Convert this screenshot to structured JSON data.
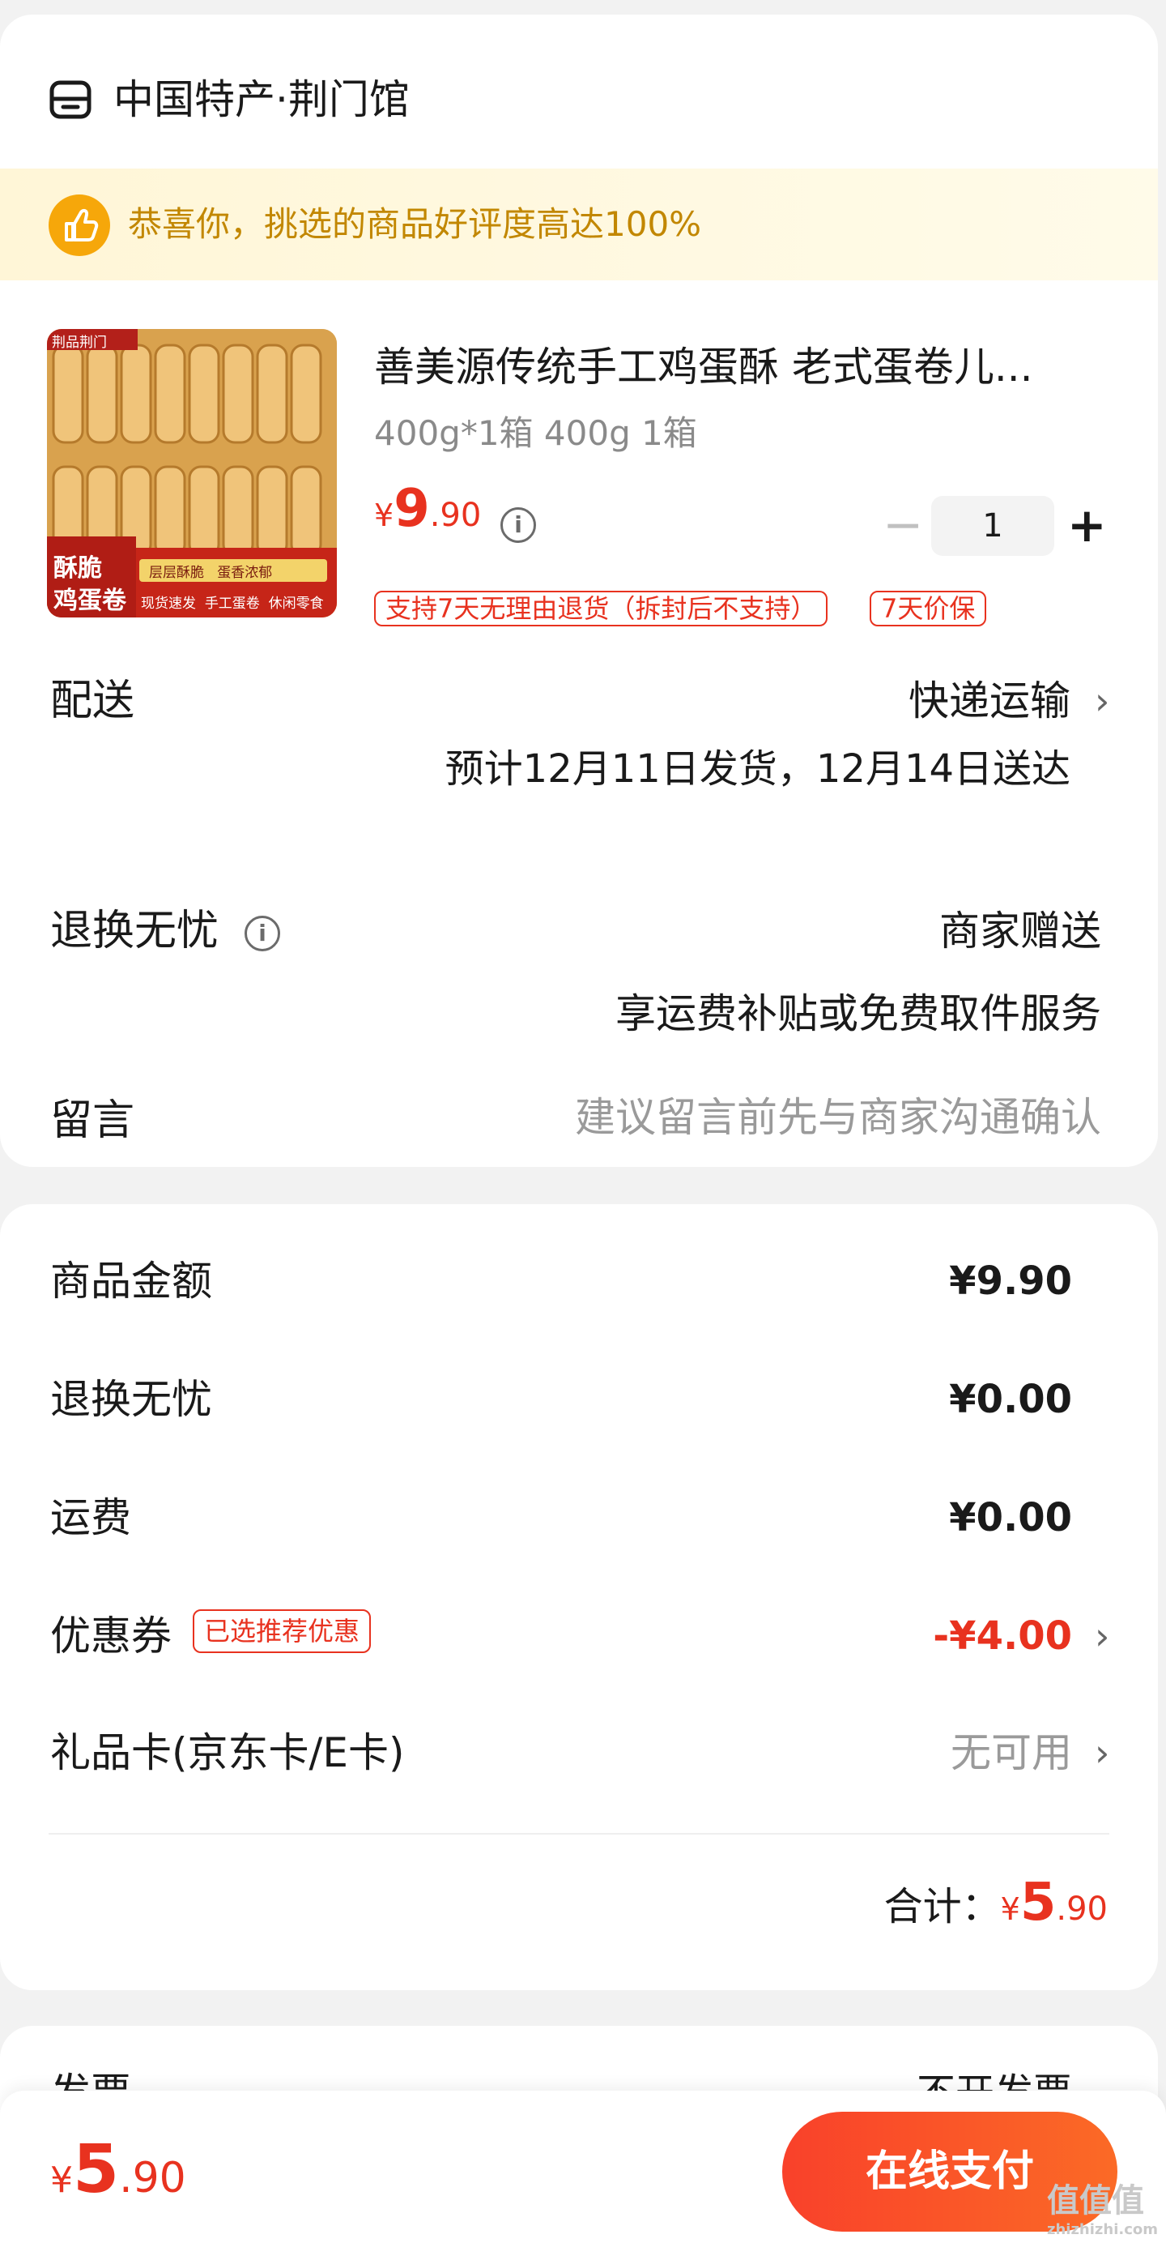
{
  "store": {
    "name": "中国特产·荆门馆",
    "banner": "恭喜你，挑选的商品好评度高达100%"
  },
  "product": {
    "title": "善美源传统手工鸡蛋酥 老式蛋卷儿...",
    "spec": "400g*1箱 400g 1箱",
    "price_currency": "¥",
    "price_int": "9",
    "price_dec": ".90",
    "quantity": "1",
    "tags": [
      "支持7天无理由退货（拆封后不支持）",
      "7天价保"
    ],
    "image_text": {
      "brand": "荆品荆门",
      "name_line1": "酥脆",
      "name_line2": "鸡蛋卷",
      "slogan1": "层层酥脆",
      "slogan2": "蛋香浓郁",
      "slogan3": "现货速发",
      "slogan4": "手工蛋卷",
      "slogan5": "休闲零食"
    }
  },
  "delivery": {
    "label": "配送",
    "method": "快递运输",
    "estimate": "预计12月11日发货，12月14日送达"
  },
  "return_service": {
    "label": "退换无忧",
    "value": "商家赠送",
    "desc": "享运费补贴或免费取件服务"
  },
  "message": {
    "label": "留言",
    "placeholder": "建议留言前先与商家沟通确认"
  },
  "summary": {
    "rows": [
      {
        "label": "商品金额",
        "value": "¥9.90"
      },
      {
        "label": "退换无忧",
        "value": "¥0.00"
      },
      {
        "label": "运费",
        "value": "¥0.00"
      }
    ],
    "coupon_label": "优惠券",
    "coupon_tag": "已选推荐优惠",
    "coupon_value": "-¥4.00",
    "giftcard_label": "礼品卡(京东卡/E卡)",
    "giftcard_value": "无可用",
    "total_label": "合计：",
    "total_currency": "¥",
    "total_int": "5",
    "total_dec": ".90"
  },
  "invoice": {
    "label": "发票",
    "value": "不开发票"
  },
  "footer": {
    "currency": "¥",
    "price_int": "5",
    "price_dec": ".90",
    "pay_label": "在线支付",
    "watermark": "值值值",
    "watermark_sub": "zhizhizhi.com"
  },
  "colors": {
    "accent_red": "#e8321f",
    "banner_gold": "#c28700",
    "pay_button": "#f9412a"
  }
}
